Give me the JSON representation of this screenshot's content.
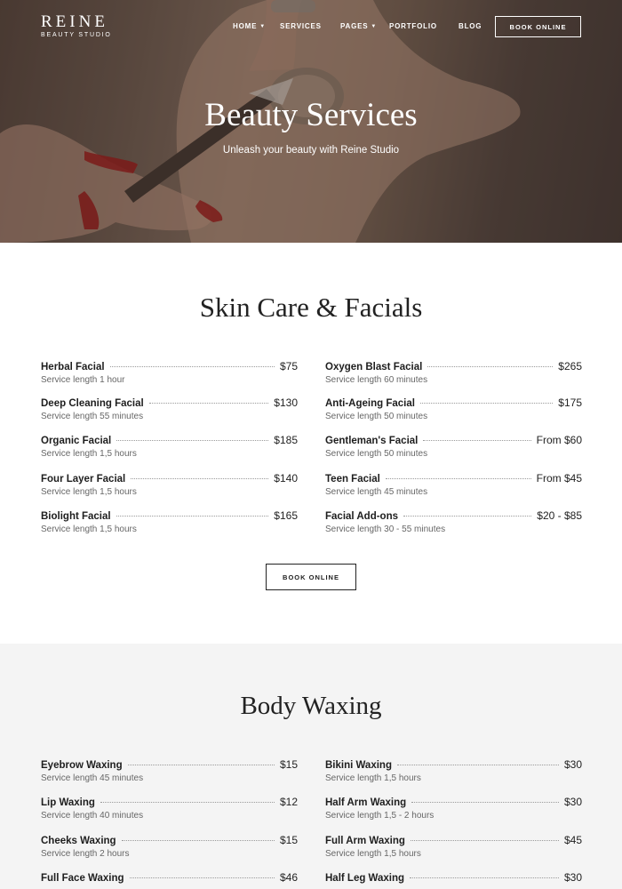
{
  "brand": {
    "name": "REINE",
    "tagline": "BEAUTY STUDIO"
  },
  "nav": {
    "items": [
      {
        "label": "HOME",
        "has_dropdown": true
      },
      {
        "label": "SERVICES",
        "has_dropdown": false
      },
      {
        "label": "PAGES",
        "has_dropdown": true
      },
      {
        "label": "PORTFOLIO",
        "has_dropdown": false
      },
      {
        "label": "BLOG",
        "has_dropdown": false
      }
    ],
    "book_label": "BOOK ONLINE",
    "dropdown_icon": "chevron-down-icon"
  },
  "hero": {
    "title": "Beauty Services",
    "subtitle": "Unleash your beauty with Reine Studio"
  },
  "skin_care": {
    "title": "Skin Care & Facials",
    "left": [
      {
        "name": "Herbal Facial",
        "price": "$75",
        "length": "Service length 1 hour"
      },
      {
        "name": "Deep Cleaning Facial",
        "price": "$130",
        "length": "Service length 55 minutes"
      },
      {
        "name": "Organic Facial",
        "price": "$185",
        "length": "Service length 1,5 hours"
      },
      {
        "name": "Four Layer Facial",
        "price": "$140",
        "length": "Service length 1,5 hours"
      },
      {
        "name": "Biolight Facial",
        "price": "$165",
        "length": "Service length 1,5 hours"
      }
    ],
    "right": [
      {
        "name": "Oxygen Blast Facial",
        "price": "$265",
        "length": "Service length 60 minutes"
      },
      {
        "name": "Anti-Ageing Facial",
        "price": "$175",
        "length": "Service length 50 minutes"
      },
      {
        "name": "Gentleman's Facial",
        "price": "From $60",
        "length": "Service length 50 minutes"
      },
      {
        "name": "Teen Facial",
        "price": "From $45",
        "length": "Service length 45 minutes"
      },
      {
        "name": "Facial Add-ons",
        "price": "$20 - $85",
        "length": "Service length 30 - 55 minutes"
      }
    ],
    "book_label": "BOOK ONLINE"
  },
  "waxing": {
    "title": "Body Waxing",
    "left": [
      {
        "name": "Eyebrow Waxing",
        "price": "$15",
        "length": "Service length 45 minutes"
      },
      {
        "name": "Lip Waxing",
        "price": "$12",
        "length": "Service length 40 minutes"
      },
      {
        "name": "Cheeks Waxing",
        "price": "$15",
        "length": "Service length 2 hours"
      },
      {
        "name": "Full Face Waxing",
        "price": "$46",
        "length": ""
      }
    ],
    "right": [
      {
        "name": "Bikini Waxing",
        "price": "$30",
        "length": "Service length 1,5 hours"
      },
      {
        "name": "Half Arm Waxing",
        "price": "$30",
        "length": "Service length 1,5 - 2 hours"
      },
      {
        "name": "Full Arm Waxing",
        "price": "$45",
        "length": "Service length 1,5 hours"
      },
      {
        "name": "Half Leg Waxing",
        "price": "$30",
        "length": ""
      }
    ]
  }
}
